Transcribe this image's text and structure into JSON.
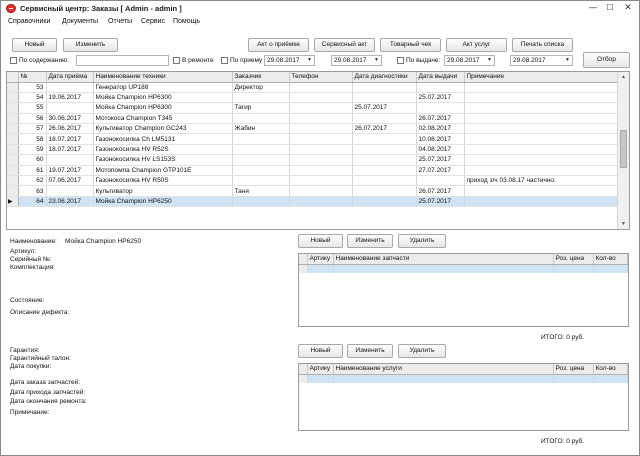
{
  "window": {
    "title": "Сервисный центр: Заказы [ Admin - admin ]",
    "min": "—",
    "max": "☐",
    "close": "✕"
  },
  "menu": [
    "Справочники",
    "Документы",
    "Отчеты",
    "Сервис",
    "Помощь"
  ],
  "toolbar": {
    "new_label": "Новый",
    "edit_label": "Изменить",
    "act_reception": "Акт о приёмке",
    "act_service": "Сервисный акт",
    "receipt": "Товарный чек",
    "act_services": "Акт услуг",
    "print_list": "Печать списка",
    "filter_btn": "Отбор"
  },
  "filters": {
    "by_content_label": "По содержанию:",
    "by_content_value": "",
    "in_repair_label": "В ремонте",
    "by_reception_label": "По приему",
    "reception_from": "29.08.2017",
    "reception_to": "29.08.2017",
    "by_issue_label": "По выдаче:",
    "issue_from": "29.08.2017",
    "issue_to": "29.08.2017"
  },
  "orders": {
    "columns": [
      "",
      "№",
      "Дата приёма",
      "Наименование техники",
      "Заказчик",
      "Телефон",
      "Дата диагностики",
      "Дата выдачи",
      "Примечание"
    ],
    "rows": [
      {
        "num": "53",
        "date": "",
        "name": "Генератор UP188",
        "customer": "Директор",
        "phone": "",
        "diag": "",
        "issue": "",
        "note": ""
      },
      {
        "num": "54",
        "date": "19.06.2017",
        "name": "Мойка Champion HP6300",
        "customer": "",
        "phone": "",
        "diag": "",
        "issue": "25.07.2017",
        "note": ""
      },
      {
        "num": "55",
        "date": "",
        "name": "Мойка Champion HP6300",
        "customer": "Тагир",
        "phone": "",
        "diag": "25.07.2017",
        "issue": "",
        "note": ""
      },
      {
        "num": "56",
        "date": "30.06.2017",
        "name": "Мотокоса Champion T345",
        "customer": "",
        "phone": "",
        "diag": "",
        "issue": "26.07.2017",
        "note": ""
      },
      {
        "num": "57",
        "date": "26.06.2017",
        "name": "Культиватор Champion GC243",
        "customer": "Жабин",
        "phone": "",
        "diag": "26.07.2017",
        "issue": "02.08.2017",
        "note": ""
      },
      {
        "num": "58",
        "date": "18.07.2017",
        "name": "Газонокосилка Ch LM5131",
        "customer": "",
        "phone": "",
        "diag": "",
        "issue": "10.08.2017",
        "note": ""
      },
      {
        "num": "59",
        "date": "18.07.2017",
        "name": "Газонокосилка HV R52S",
        "customer": "",
        "phone": "",
        "diag": "",
        "issue": "04.08.2017",
        "note": ""
      },
      {
        "num": "60",
        "date": "",
        "name": "Газонокосилка HV LS153S",
        "customer": "",
        "phone": "",
        "diag": "",
        "issue": "25.07.2017",
        "note": ""
      },
      {
        "num": "61",
        "date": "19.07.2017",
        "name": "Мотопомпа Champion GTP101E",
        "customer": "",
        "phone": "",
        "diag": "",
        "issue": "27.07.2017",
        "note": ""
      },
      {
        "num": "62",
        "date": "07.06.2017",
        "name": "Газонокосилка HV R50S",
        "customer": "",
        "phone": "",
        "diag": "",
        "issue": "",
        "note": "приход з/ч 03.08.17 частично."
      },
      {
        "num": "63",
        "date": "",
        "name": "Культиватор",
        "customer": "Таня",
        "phone": "",
        "diag": "",
        "issue": "26.07.2017",
        "note": ""
      },
      {
        "num": "64",
        "date": "23.06.2017",
        "name": "Мойка Champion HP6250",
        "customer": "",
        "phone": "",
        "diag": "",
        "issue": "25.07.2017",
        "note": ""
      }
    ],
    "selected_marker": "▶",
    "scroll_up": "▲",
    "scroll_down": "▼"
  },
  "details": {
    "name_label": "Наименование:",
    "name_value": "Мойка Champion HP6250",
    "article_label": "Артикул:",
    "serial_label": "Серийный №:",
    "kit_label": "Комплектация:",
    "state_label": "Состояние:",
    "defect_label": "Описание дефекта:",
    "warranty_label": "Гарантия:",
    "warranty_card_label": "Гарантийный талон:",
    "purchase_date_label": "Дата покупки:",
    "parts_order_date_label": "Дата заказа запчастей:",
    "parts_arrival_date_label": "Дата прихода запчастей:",
    "repair_end_date_label": "Дата окончания ремонта:",
    "note_label": "Примечание:"
  },
  "parts": {
    "new_label": "Новый",
    "edit_label": "Изменить",
    "delete_label": "Удалить",
    "columns": [
      "",
      "Артику",
      "Наименование запчасти",
      "Роз. цена",
      "Кол-во"
    ],
    "total": "ИТОГО: 0 руб."
  },
  "services": {
    "new_label": "Новый",
    "edit_label": "Изменить",
    "delete_label": "Удалить",
    "columns": [
      "",
      "Артику",
      "Наименование услуги",
      "Роз. цена",
      "Кол-во"
    ],
    "total": "ИТОГО: 0 руб."
  }
}
